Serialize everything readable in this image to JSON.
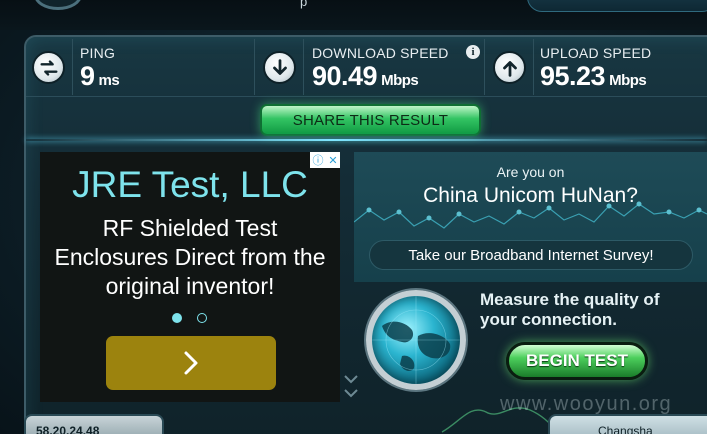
{
  "top_bar": {
    "crumb": "p"
  },
  "stats": {
    "ping": {
      "label": "PING",
      "value": "9",
      "unit": "ms",
      "icon": "ping-arrows-icon"
    },
    "download": {
      "label": "DOWNLOAD SPEED",
      "value": "90.49",
      "unit": "Mbps",
      "icon": "download-arrow-icon",
      "info": "i"
    },
    "upload": {
      "label": "UPLOAD SPEED",
      "value": "95.23",
      "unit": "Mbps",
      "icon": "upload-arrow-icon"
    }
  },
  "share_button": {
    "label": "SHARE THIS RESULT"
  },
  "ad": {
    "title": "JRE Test, LLC",
    "body": "RF Shielded Test Enclosures Direct from the original inventor!",
    "choices_icons": [
      "adchoices-info-icon",
      "adchoices-close-icon"
    ],
    "dots": {
      "count": 2,
      "active": 0
    },
    "cta_icon": "chevron-right-icon",
    "colors": {
      "accent": "#7ee3ec",
      "cta": "#9c830e"
    }
  },
  "survey": {
    "question_line1": "Are you on",
    "question_line2": "China Unicom HuNan?",
    "button_label": "Take our Broadband Internet Survey!"
  },
  "measure": {
    "text": "Measure the quality of your connection.",
    "button_label": "BEGIN TEST",
    "globe_icon": "globe-icon"
  },
  "footer": {
    "ip": "58.20.24.48",
    "city": "Changsha",
    "watermark": "www.wooyun.org"
  },
  "colors": {
    "share_button": "#33c463",
    "begin_button": "#4ccf5c",
    "background": "#0d1f28"
  }
}
